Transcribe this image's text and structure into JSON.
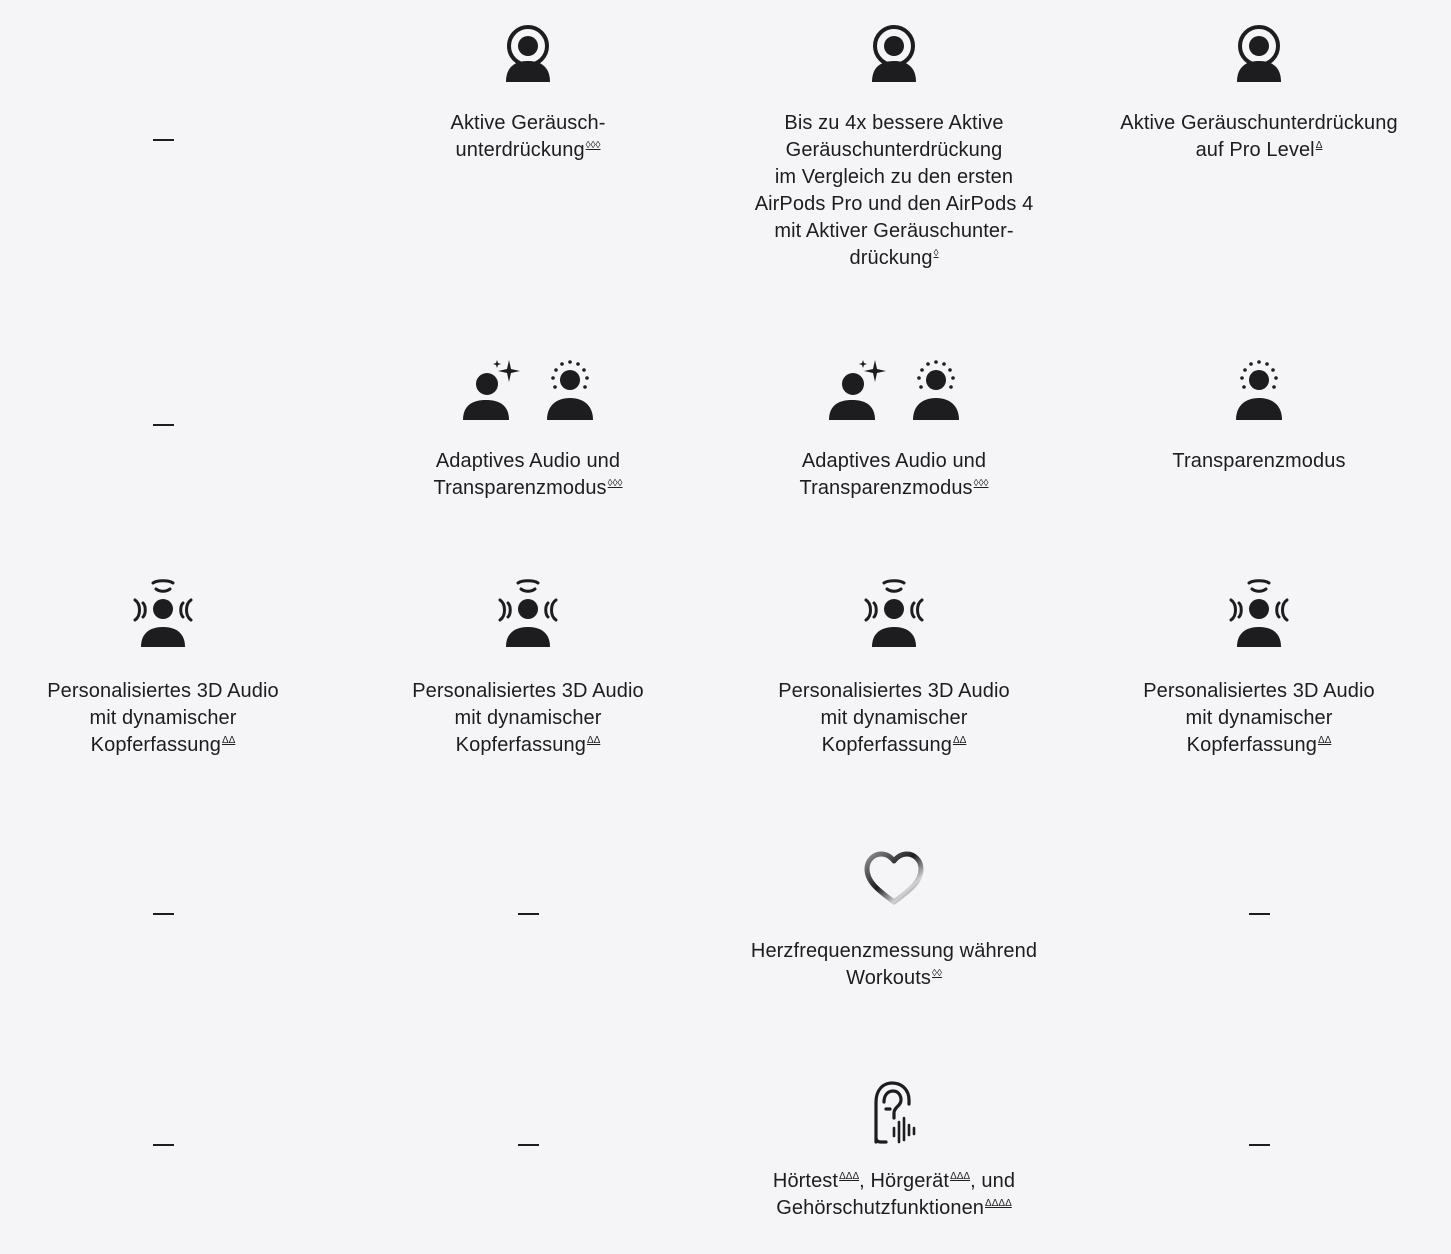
{
  "rows": [
    {
      "cells": [
        {
          "dash": true
        },
        {
          "lines": [
            "Aktive Geräusch-",
            "unterdrückung"
          ],
          "fn": "◊◊◊"
        },
        {
          "lines": [
            "Bis zu 4x bessere Aktive",
            "Geräuschunterdrückung",
            "im Vergleich zu den ersten",
            "AirPods Pro und den AirPods 4",
            "mit Aktiver Geräuschunter-",
            "drückung"
          ],
          "fn": "◊"
        },
        {
          "lines": [
            "Aktive Geräuschunterdrückung",
            "auf Pro Level"
          ],
          "fn": "Δ"
        }
      ]
    },
    {
      "cells": [
        {
          "dash": true
        },
        {
          "lines": [
            "Adaptives Audio und",
            "Transparenzmodus"
          ],
          "fn": "◊◊◊"
        },
        {
          "lines": [
            "Adaptives Audio und",
            "Transparenzmodus"
          ],
          "fn": "◊◊◊"
        },
        {
          "lines": [
            "Transparenzmodus"
          ],
          "fn": ""
        }
      ]
    },
    {
      "cells": [
        {
          "lines": [
            "Personalisiertes 3D Audio",
            "mit dynamischer",
            "Kopferfassung"
          ],
          "fn": "ΔΔ"
        },
        {
          "lines": [
            "Personalisiertes 3D Audio",
            "mit dynamischer",
            "Kopferfassung"
          ],
          "fn": "ΔΔ"
        },
        {
          "lines": [
            "Personalisiertes 3D Audio",
            "mit dynamischer",
            "Kopferfassung"
          ],
          "fn": "ΔΔ"
        },
        {
          "lines": [
            "Personalisiertes 3D Audio",
            "mit dynamischer",
            "Kopferfassung"
          ],
          "fn": "ΔΔ"
        }
      ]
    },
    {
      "cells": [
        {
          "dash": true
        },
        {
          "dash": true
        },
        {
          "lines": [
            "Herzfrequenzmessung während",
            "Workouts"
          ],
          "fn": "◊◊"
        },
        {
          "dash": true
        }
      ]
    },
    {
      "cells": [
        {
          "dash": true
        },
        {
          "dash": true
        },
        {
          "rich": true,
          "part1": "Hörtest",
          "fn1": "ΔΔΔ",
          "part2": ", Hörgerät",
          "fn2": "ΔΔΔ",
          "part3": ", und",
          "line2": "Gehörschutzfunktionen",
          "fn3": "ΔΔΔΔ"
        },
        {
          "dash": true
        }
      ]
    }
  ],
  "icons": {
    "anc": "person-with-halo-icon",
    "adaptive": "person-sparkle-icon",
    "transparency": "person-dotted-ring-icon",
    "spatial": "person-spatial-audio-icon",
    "heart": "heart-outline-icon",
    "hearing": "ear-waveform-icon"
  },
  "colors": {
    "background": "#f5f5f7",
    "text": "#1d1d1f"
  }
}
